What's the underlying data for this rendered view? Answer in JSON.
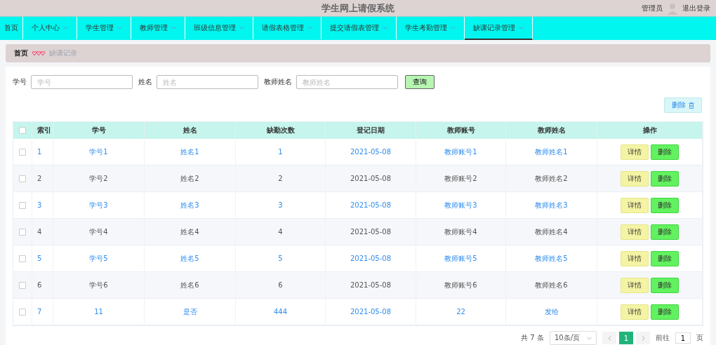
{
  "header": {
    "title": "学生网上请假系统",
    "user": "管理员",
    "logout": "退出登录"
  },
  "nav": [
    {
      "label": "首页",
      "dropdown": false,
      "selected": false
    },
    {
      "label": "个人中心",
      "dropdown": true,
      "selected": false
    },
    {
      "label": "学生管理",
      "dropdown": true,
      "selected": false
    },
    {
      "label": "教师管理",
      "dropdown": true,
      "selected": false
    },
    {
      "label": "班级信息管理",
      "dropdown": true,
      "selected": false
    },
    {
      "label": "请假表格管理",
      "dropdown": true,
      "selected": false
    },
    {
      "label": "提交请假表管理",
      "dropdown": true,
      "selected": false
    },
    {
      "label": "学生考勤管理",
      "dropdown": true,
      "selected": false
    },
    {
      "label": "缺课记录管理",
      "dropdown": true,
      "selected": true
    }
  ],
  "breadcrumb": {
    "home": "首页",
    "current": "缺课记录"
  },
  "search": {
    "fields": [
      {
        "label": "学号",
        "placeholder": "学号"
      },
      {
        "label": "姓名",
        "placeholder": "姓名"
      },
      {
        "label": "教师姓名",
        "placeholder": "教师姓名"
      }
    ],
    "button": "查询"
  },
  "delete_button": "删除",
  "table": {
    "columns": [
      "索引",
      "学号",
      "姓名",
      "缺勤次数",
      "登记日期",
      "教师账号",
      "教师姓名",
      "操作"
    ],
    "rows": [
      {
        "cells": [
          "1",
          "学号1",
          "姓名1",
          "1",
          "2021-05-08",
          "教师账号1",
          "教师姓名1"
        ],
        "checked": false,
        "actions": [
          "详情",
          "删除"
        ]
      },
      {
        "cells": [
          "2",
          "学号2",
          "姓名2",
          "2",
          "2021-05-08",
          "教师账号2",
          "教师姓名2"
        ],
        "checked": false,
        "actions": [
          "详情",
          "删除"
        ]
      },
      {
        "cells": [
          "3",
          "学号3",
          "姓名3",
          "3",
          "2021-05-08",
          "教师账号3",
          "教师姓名3"
        ],
        "checked": false,
        "actions": [
          "详情",
          "删除"
        ]
      },
      {
        "cells": [
          "4",
          "学号4",
          "姓名4",
          "4",
          "2021-05-08",
          "教师账号4",
          "教师姓名4"
        ],
        "checked": false,
        "actions": [
          "详情",
          "删除"
        ]
      },
      {
        "cells": [
          "5",
          "学号5",
          "姓名5",
          "5",
          "2021-05-08",
          "教师账号5",
          "教师姓名5"
        ],
        "checked": false,
        "actions": [
          "详情",
          "删除"
        ]
      },
      {
        "cells": [
          "6",
          "学号6",
          "姓名6",
          "6",
          "2021-05-08",
          "教师账号6",
          "教师姓名6"
        ],
        "checked": false,
        "actions": [
          "详情",
          "删除"
        ]
      },
      {
        "cells": [
          "7",
          "11",
          "是否",
          "444",
          "2021-05-08",
          "22",
          "发给"
        ],
        "checked": false,
        "actions": [
          "详情",
          "删除"
        ]
      }
    ],
    "select_all_checked": false
  },
  "pagination": {
    "total": "共 7 条",
    "page_size": "10条/页",
    "pages": [
      {
        "label": "1",
        "selected": true
      }
    ],
    "jump_label": "前往",
    "jump_value": "1",
    "jump_suffix": "页"
  }
}
